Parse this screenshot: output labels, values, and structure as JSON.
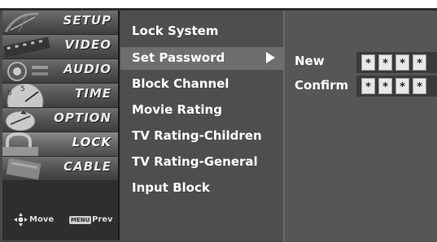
{
  "categories": [
    {
      "label": "SETUP"
    },
    {
      "label": "VIDEO"
    },
    {
      "label": "AUDIO"
    },
    {
      "label": "TIME"
    },
    {
      "label": "OPTION"
    },
    {
      "label": "LOCK"
    },
    {
      "label": "CABLE"
    }
  ],
  "active_category": "LOCK",
  "help": {
    "move_label": "Move",
    "menu_key_label": "MENU",
    "prev_label": "Prev"
  },
  "menu": {
    "items": [
      {
        "label": "Lock System"
      },
      {
        "label": "Set Password"
      },
      {
        "label": "Block Channel"
      },
      {
        "label": "Movie Rating"
      },
      {
        "label": "TV Rating-Children"
      },
      {
        "label": "TV Rating-General"
      },
      {
        "label": "Input Block"
      }
    ],
    "selected": "Set Password"
  },
  "password": {
    "new_label": "New",
    "confirm_label": "Confirm",
    "new_digits": [
      "*",
      "*",
      "*",
      "*"
    ],
    "confirm_digits": [
      "*",
      "*",
      "*",
      "*"
    ]
  }
}
